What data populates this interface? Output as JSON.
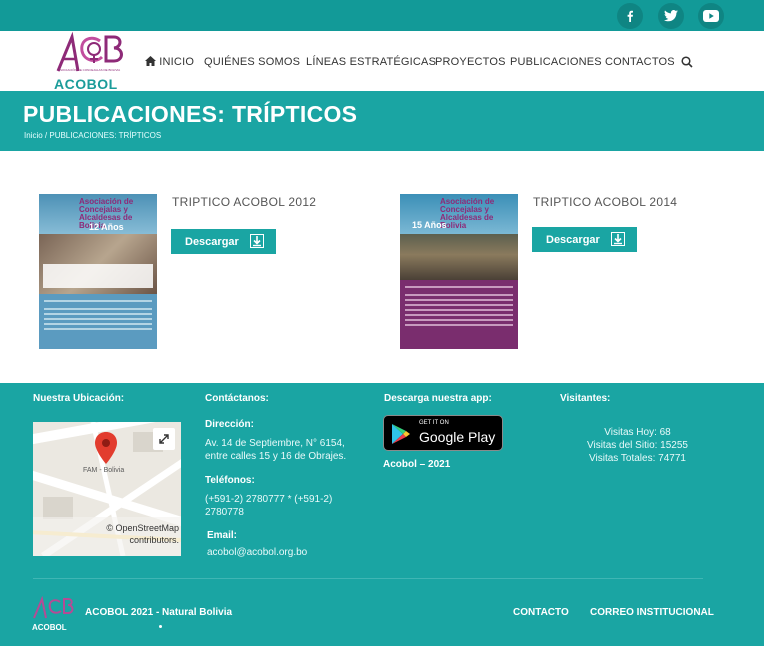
{
  "social": {
    "icons": [
      "facebook-icon",
      "twitter-icon",
      "youtube-icon"
    ]
  },
  "header": {
    "logo_text": "ACOBOL",
    "logo_small_text": "ASOCIACIÓN DE CONCEJALAS DE BOLIVIA",
    "nav": {
      "inicio": "INICIO",
      "quienes": "QUIÉNES SOMOS",
      "lineas": "LÍNEAS ESTRATÉGICAS",
      "proyectos": "PROYECTOS",
      "publicaciones": "PUBLICACIONES",
      "contactos": "CONTACTOS"
    }
  },
  "banner": {
    "title": "PUBLICACIONES: TRÍPTICOS",
    "crumb_home": "Inicio",
    "crumb_sep": " / ",
    "crumb_current": "PUBLICACIONES: TRÍPTICOS"
  },
  "cards": [
    {
      "title": "TRIPTICO ACOBOL 2012",
      "button": "Descargar",
      "thumb_heading": "Asociación de Concejalas y Alcaldesas de Bolivia",
      "thumb_years": "12 Años"
    },
    {
      "title": "TRIPTICO ACOBOL 2014",
      "button": "Descargar",
      "thumb_heading": "Asociación de Concejalas y Alcaldesas de Bolivia",
      "thumb_years": "15 Años"
    }
  ],
  "footer": {
    "ubicacion_title": "Nuestra Ubicación:",
    "map_label": "FAM - Bolivia",
    "map_attrib": "© OpenStreetMap contributors.",
    "contact_title": "Contáctanos:",
    "direccion_label": "Dirección:",
    "direccion_text": "Av. 14 de Septiembre, N° 6154, entre calles 15 y 16 de Obrajes.",
    "telefonos_label": "Teléfonos:",
    "telefonos_text": "(+591-2) 2780777 * (+591-2) 2780778",
    "email_label": "Email:",
    "email_text": "acobol@acobol.org.bo",
    "app_title": "Descarga nuestra app:",
    "gplay_small": "GET IT ON",
    "gplay_big": "Google Play",
    "app_caption": "Acobol – 2021",
    "visit_title": "Visitantes:",
    "visitas_hoy": "Visitas Hoy: 68",
    "visitas_sitio": "Visitas del Sitio: 15255",
    "visitas_totales": "Visitas Totales: 74771",
    "logo_text": "ACOBOL",
    "copyright": "ACOBOL 2021 - Natural Bolivia",
    "link_contacto": "CONTACTO",
    "link_correo": "CORREO INSTITUCIONAL"
  },
  "colors": {
    "teal": "#1aa5a3",
    "teal_dark": "#129a98",
    "magenta": "#8e2a78"
  }
}
